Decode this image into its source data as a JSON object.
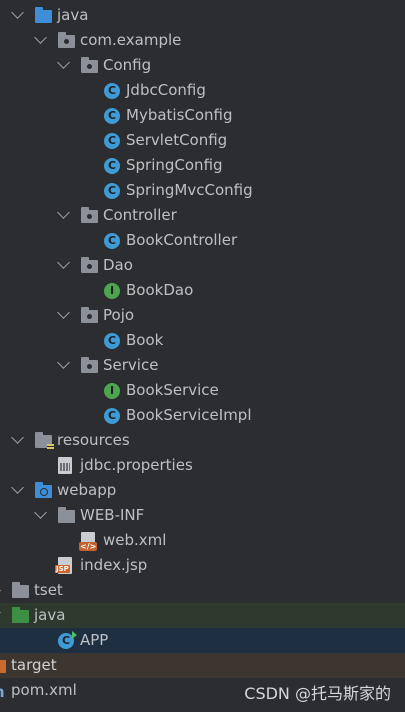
{
  "tree": [
    {
      "label": "java",
      "indent": 0,
      "expanded": true,
      "icon": "folder-source-icon",
      "kind": "folder",
      "color": "blue"
    },
    {
      "label": "com.example",
      "indent": 1,
      "expanded": true,
      "icon": "package-icon",
      "kind": "pkg"
    },
    {
      "label": "Config",
      "indent": 2,
      "expanded": true,
      "icon": "package-icon",
      "kind": "pkg"
    },
    {
      "label": "JdbcConfig",
      "indent": 3,
      "icon": "class-icon",
      "kind": "class"
    },
    {
      "label": "MybatisConfig",
      "indent": 3,
      "icon": "class-icon",
      "kind": "class"
    },
    {
      "label": "ServletConfig",
      "indent": 3,
      "icon": "class-icon",
      "kind": "class"
    },
    {
      "label": "SpringConfig",
      "indent": 3,
      "icon": "class-icon",
      "kind": "class"
    },
    {
      "label": "SpringMvcConfig",
      "indent": 3,
      "icon": "class-icon",
      "kind": "class"
    },
    {
      "label": "Controller",
      "indent": 2,
      "expanded": true,
      "icon": "package-icon",
      "kind": "pkg"
    },
    {
      "label": "BookController",
      "indent": 3,
      "icon": "class-icon",
      "kind": "class"
    },
    {
      "label": "Dao",
      "indent": 2,
      "expanded": true,
      "icon": "package-icon",
      "kind": "pkg"
    },
    {
      "label": "BookDao",
      "indent": 3,
      "icon": "interface-icon",
      "kind": "interface"
    },
    {
      "label": "Pojo",
      "indent": 2,
      "expanded": true,
      "icon": "package-icon",
      "kind": "pkg"
    },
    {
      "label": "Book",
      "indent": 3,
      "icon": "class-icon",
      "kind": "class"
    },
    {
      "label": "Service",
      "indent": 2,
      "expanded": true,
      "icon": "package-icon",
      "kind": "pkg"
    },
    {
      "label": "BookService",
      "indent": 3,
      "icon": "interface-icon",
      "kind": "interface"
    },
    {
      "label": "BookServiceImpl",
      "indent": 3,
      "icon": "class-icon",
      "kind": "class"
    },
    {
      "label": "resources",
      "indent": 0,
      "expanded": true,
      "icon": "resources-folder-icon",
      "kind": "res"
    },
    {
      "label": "jdbc.properties",
      "indent": 1,
      "icon": "properties-file-icon",
      "kind": "props"
    },
    {
      "label": "webapp",
      "indent": 0,
      "expanded": true,
      "icon": "web-folder-icon",
      "kind": "web"
    },
    {
      "label": "WEB-INF",
      "indent": 1,
      "expanded": true,
      "icon": "folder-icon",
      "kind": "folder",
      "color": "grey"
    },
    {
      "label": "web.xml",
      "indent": 2,
      "icon": "xml-file-icon",
      "kind": "xml"
    },
    {
      "label": "index.jsp",
      "indent": 1,
      "icon": "jsp-file-icon",
      "kind": "jsp"
    },
    {
      "label": "tset",
      "indent": -1,
      "expanded": false,
      "icon": "folder-icon",
      "kind": "folder",
      "color": "grey"
    },
    {
      "label": "java",
      "indent": -1,
      "expanded": true,
      "icon": "test-folder-icon",
      "kind": "folder",
      "color": "green",
      "highlight": "green"
    },
    {
      "label": "APP",
      "indent": 1,
      "icon": "app-class-icon",
      "kind": "app",
      "highlight": "blue"
    },
    {
      "label": "target",
      "indent": -2,
      "icon": "folder-icon",
      "kind": "folder",
      "color": "orange",
      "highlight": "brown"
    },
    {
      "label": "pom.xml",
      "indent": -2,
      "icon": "maven-file-icon",
      "kind": "mvn"
    }
  ],
  "watermark": "CSDN @托马斯家的"
}
